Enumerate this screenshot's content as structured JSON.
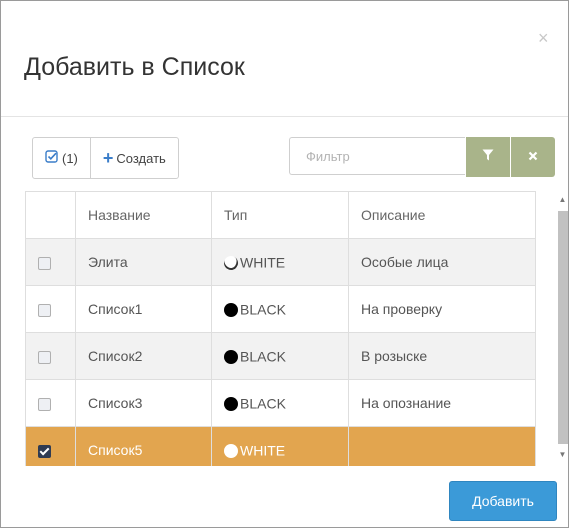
{
  "modal": {
    "title": "Добавить в Список",
    "close_glyph": "×"
  },
  "toolbar": {
    "selected_count_label": "(1)",
    "selected_icon": "check-square-icon",
    "create_label": "Создать",
    "create_icon": "plus-icon",
    "filter_placeholder": "Фильтр",
    "filter_apply_icon": "funnel-icon",
    "filter_clear_icon": "x-icon",
    "accent_color": "#3a7dc9",
    "filter_button_color": "#a9b48a"
  },
  "table": {
    "columns": [
      "",
      "Название",
      "Тип",
      "Описание"
    ],
    "rows": [
      {
        "checked": false,
        "name": "Элита",
        "type": "WHITE",
        "type_icon": "white-half-circle-icon",
        "description": "Особые лица"
      },
      {
        "checked": false,
        "name": "Список1",
        "type": "BLACK",
        "type_icon": "black-circle-icon",
        "description": "На проверку"
      },
      {
        "checked": false,
        "name": "Список2",
        "type": "BLACK",
        "type_icon": "black-circle-icon",
        "description": "В розыске"
      },
      {
        "checked": false,
        "name": "Список3",
        "type": "BLACK",
        "type_icon": "black-circle-icon",
        "description": "На опознание"
      },
      {
        "checked": true,
        "name": "Список5",
        "type": "WHITE",
        "type_icon": "white-circle-icon",
        "description": ""
      }
    ],
    "selected_row_color": "#e2a54f"
  },
  "footer": {
    "add_label": "Добавить",
    "add_color": "#3b9ad8"
  }
}
